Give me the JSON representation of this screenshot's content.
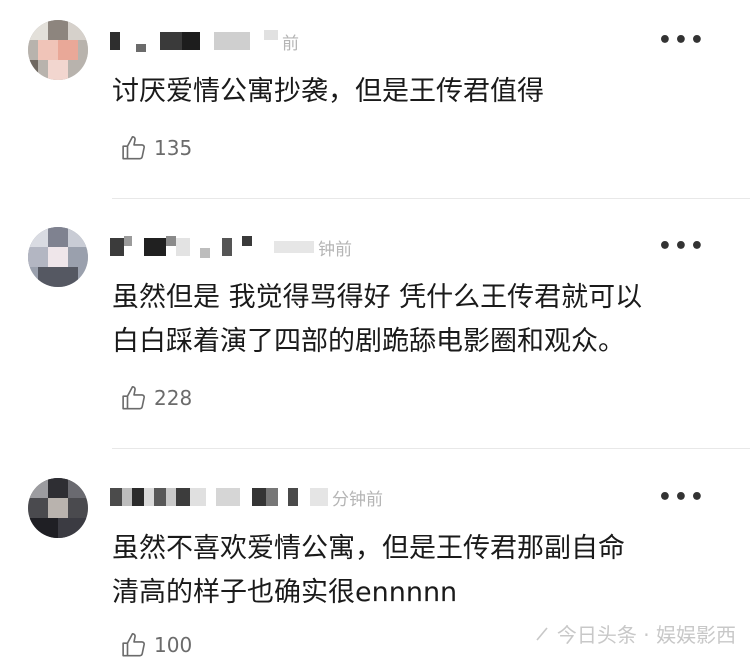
{
  "comments": [
    {
      "time": "前",
      "text": "讨厌爱情公寓抄袭，但是王传君值得",
      "likes": "135",
      "more": "•••"
    },
    {
      "time": "钟前",
      "text_line1": "虽然但是 我觉得骂得好 凭什么王传君就可以",
      "text_line2": "白白踩着演了四部的剧跪舔电影圈和观众。",
      "likes": "228",
      "more": "•••"
    },
    {
      "time": "分钟前",
      "text_line1": "虽然不喜欢爱情公寓，但是王传君那副自命",
      "text_line2": "清高的样子也确实很ennnnn",
      "likes": "100",
      "more": "•••"
    }
  ],
  "watermark": "今日头条 · 娱娱影西",
  "icons": {
    "like": "thumbs-up-icon",
    "more": "more-dots-icon",
    "watermark": "pen-icon"
  }
}
